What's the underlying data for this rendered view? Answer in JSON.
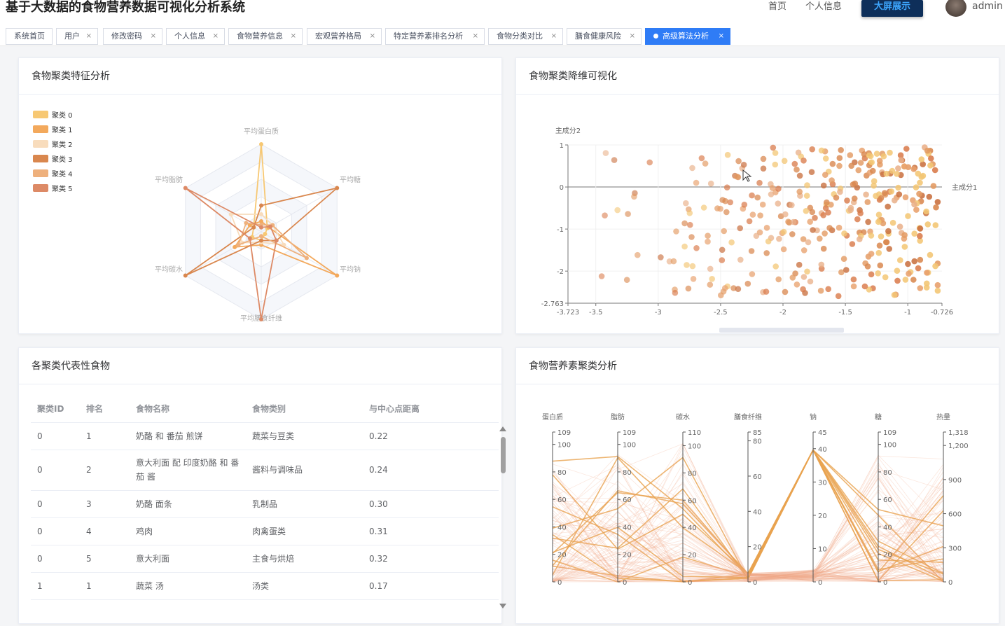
{
  "header": {
    "title": "基于大数据的食物营养数据可视化分析系统",
    "nav": [
      "首页",
      "个人信息"
    ],
    "bigscreen": "大屏展示",
    "user": "admin"
  },
  "tabs": [
    {
      "label": "系统首页",
      "closable": false
    },
    {
      "label": "用户",
      "closable": true
    },
    {
      "label": "修改密码",
      "closable": true
    },
    {
      "label": "个人信息",
      "closable": true
    },
    {
      "label": "食物营养信息",
      "closable": true
    },
    {
      "label": "宏观营养格局",
      "closable": true
    },
    {
      "label": "特定营养素排名分析",
      "closable": true
    },
    {
      "label": "食物分类对比",
      "closable": true
    },
    {
      "label": "膳食健康风险",
      "closable": true
    },
    {
      "label": "高级算法分析",
      "closable": true,
      "active": true
    }
  ],
  "tab_close": "×",
  "radar": {
    "title": "食物聚类特征分析",
    "indicators": [
      "平均蛋白质",
      "平均糖",
      "平均钠",
      "平均膳食纤维",
      "平均碳水",
      "平均脂肪"
    ],
    "clusters": [
      {
        "name": "聚类 0",
        "color": "#f7c873",
        "values": [
          1.0,
          0.08,
          0.05,
          0.1,
          0.12,
          0.1
        ]
      },
      {
        "name": "聚类 1",
        "color": "#f3a95c",
        "values": [
          0.12,
          0.1,
          1.0,
          0.15,
          0.35,
          0.15
        ]
      },
      {
        "name": "聚类 2",
        "color": "#f8dcbc",
        "values": [
          0.2,
          0.15,
          0.3,
          0.12,
          0.25,
          0.4
        ]
      },
      {
        "name": "聚类 3",
        "color": "#d9874e",
        "values": [
          0.3,
          1.0,
          0.2,
          0.1,
          1.0,
          0.1
        ]
      },
      {
        "name": "聚类 4",
        "color": "#eeb07c",
        "values": [
          0.08,
          0.15,
          0.6,
          0.05,
          0.3,
          0.2
        ]
      },
      {
        "name": "聚类 5",
        "color": "#dd8a66",
        "values": [
          0.05,
          0.12,
          0.2,
          1.0,
          0.15,
          1.0
        ]
      }
    ]
  },
  "scatter": {
    "title": "食物聚类降维可视化",
    "xlabel": "主成分1",
    "ylabel": "主成分2",
    "xlim": [
      -3.723,
      -0.726
    ],
    "ylim": [
      -2.763,
      1
    ],
    "xticks": [
      -3.723,
      -3.5,
      -3,
      -2.5,
      -2,
      -1.5,
      -1,
      -0.726
    ],
    "yticks": [
      1,
      0,
      -1,
      -2,
      -2.763
    ],
    "cursor": "pointer-icon"
  },
  "table": {
    "title": "各聚类代表性食物",
    "headers": [
      "聚类ID",
      "排名",
      "食物名称",
      "食物类别",
      "与中心点距离"
    ],
    "rows": [
      [
        "0",
        "1",
        "奶酪 和 番茄 煎饼",
        "蔬菜与豆类",
        "0.22"
      ],
      [
        "0",
        "2",
        "意大利面 配 印度奶酪 和 番茄 酱",
        "酱料与调味品",
        "0.24"
      ],
      [
        "0",
        "3",
        "奶酪 面条",
        "乳制品",
        "0.30"
      ],
      [
        "0",
        "4",
        "鸡肉",
        "肉禽蛋类",
        "0.31"
      ],
      [
        "0",
        "5",
        "意大利面",
        "主食与烘焙",
        "0.32"
      ],
      [
        "1",
        "1",
        "蔬菜 汤",
        "汤类",
        "0.17"
      ]
    ]
  },
  "parallel": {
    "title": "食物营养素聚类分析",
    "axes": [
      {
        "name": "蛋白质",
        "ticks": [
          "109",
          "100",
          "80",
          "60",
          "40",
          "20",
          "0"
        ]
      },
      {
        "name": "脂肪",
        "ticks": [
          "109",
          "100",
          "80",
          "60",
          "40",
          "20",
          "0"
        ]
      },
      {
        "name": "碳水",
        "ticks": [
          "110",
          "100",
          "80",
          "60",
          "40",
          "20",
          "0"
        ]
      },
      {
        "name": "膳食纤维",
        "ticks": [
          "85",
          "80",
          "60",
          "40",
          "20",
          "0"
        ]
      },
      {
        "name": "钠",
        "ticks": [
          "45",
          "40",
          "30",
          "20",
          "10",
          "0"
        ]
      },
      {
        "name": "糖",
        "ticks": [
          "109",
          "100",
          "80",
          "60",
          "40",
          "20",
          "0"
        ]
      },
      {
        "name": "热量",
        "ticks": [
          "1,318",
          "1,200",
          "900",
          "600",
          "300",
          "0"
        ]
      }
    ]
  },
  "chart_data": [
    {
      "type": "radar",
      "indicators": [
        "平均蛋白质",
        "平均糖",
        "平均钠",
        "平均膳食纤维",
        "平均碳水",
        "平均脂肪"
      ],
      "series": [
        {
          "name": "聚类 0",
          "values": [
            1.0,
            0.08,
            0.05,
            0.1,
            0.12,
            0.1
          ]
        },
        {
          "name": "聚类 1",
          "values": [
            0.12,
            0.1,
            1.0,
            0.15,
            0.35,
            0.15
          ]
        },
        {
          "name": "聚类 2",
          "values": [
            0.2,
            0.15,
            0.3,
            0.12,
            0.25,
            0.4
          ]
        },
        {
          "name": "聚类 3",
          "values": [
            0.3,
            1.0,
            0.2,
            0.1,
            1.0,
            0.1
          ]
        },
        {
          "name": "聚类 4",
          "values": [
            0.08,
            0.15,
            0.6,
            0.05,
            0.3,
            0.2
          ]
        },
        {
          "name": "聚类 5",
          "values": [
            0.05,
            0.12,
            0.2,
            1.0,
            0.15,
            1.0
          ]
        }
      ],
      "title": "食物聚类特征分析"
    },
    {
      "type": "scatter",
      "title": "食物聚类降维可视化",
      "xlabel": "主成分1",
      "ylabel": "主成分2",
      "xlim": [
        -3.723,
        -0.726
      ],
      "ylim": [
        -2.763,
        1
      ]
    },
    {
      "type": "line",
      "title": "食物营养素聚类分析",
      "categories": [
        "蛋白质",
        "脂肪",
        "碳水",
        "膳食纤维",
        "钠",
        "糖",
        "热量"
      ]
    }
  ]
}
